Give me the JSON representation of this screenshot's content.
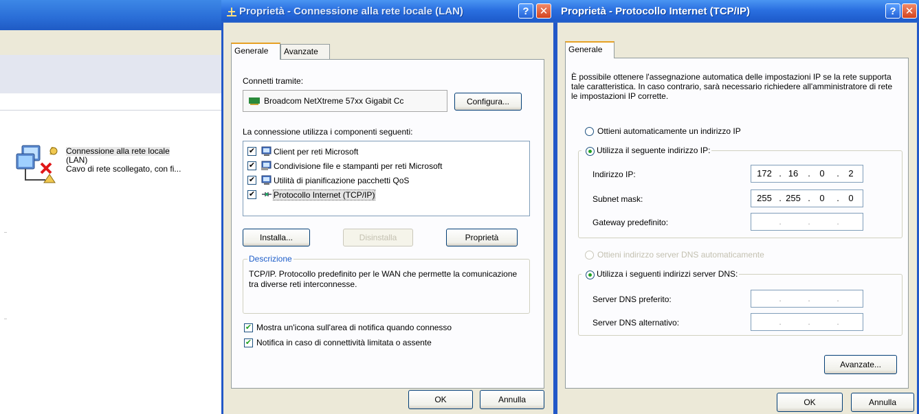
{
  "background_window": {
    "connection": {
      "name": "Connessione alla rete locale",
      "name_suffix": "(LAN)",
      "status": "Cavo di rete scollegato, con fi..."
    }
  },
  "lan_dialog": {
    "title": "Proprietà - Connessione alla rete locale (LAN)",
    "help_label": "?",
    "close_label": "✕",
    "tabs": [
      "Generale",
      "Avanzate"
    ],
    "connect_via_label": "Connetti tramite:",
    "adapter_name": "Broadcom NetXtreme 57xx Gigabit Cc",
    "configure_label": "Configura...",
    "components_label": "La connessione utilizza i componenti seguenti:",
    "components": [
      {
        "label": "Client per reti Microsoft",
        "checked": true,
        "icon": "network-client-icon"
      },
      {
        "label": "Condivisione file e stampanti per reti Microsoft",
        "checked": true,
        "icon": "file-printer-sharing-icon"
      },
      {
        "label": "Utilità di pianificazione pacchetti QoS",
        "checked": true,
        "icon": "qos-scheduler-icon"
      },
      {
        "label": "Protocollo Internet (TCP/IP)",
        "checked": true,
        "icon": "protocol-icon",
        "selected": true
      }
    ],
    "install_label": "Installa...",
    "uninstall_label": "Disinstalla",
    "properties_label": "Proprietà",
    "description_title": "Descrizione",
    "description_text": "TCP/IP. Protocollo predefinito per le WAN che permette la comunicazione tra diverse reti interconnesse.",
    "show_icon_label": "Mostra un'icona sull'area di notifica quando connesso",
    "notify_label": "Notifica in caso di connettività limitata o assente",
    "ok_label": "OK",
    "cancel_label": "Annulla"
  },
  "tcpip_dialog": {
    "title": "Proprietà - Protocollo Internet (TCP/IP)",
    "help_label": "?",
    "close_label": "✕",
    "tab": "Generale",
    "intro": "È possibile ottenere l'assegnazione automatica delle impostazioni IP se la rete supporta tale caratteristica. In caso contrario, sarà necessario richiedere all'amministratore di rete le impostazioni IP corrette.",
    "auto_ip_label": "Ottieni automaticamente un indirizzo IP",
    "manual_ip_label": "Utilizza il seguente indirizzo IP:",
    "ip_label": "Indirizzo IP:",
    "ip": [
      "172",
      "16",
      "0",
      "2"
    ],
    "mask_label": "Subnet mask:",
    "mask": [
      "255",
      "255",
      "0",
      "0"
    ],
    "gateway_label": "Gateway predefinito:",
    "auto_dns_label": "Ottieni indirizzo server DNS automaticamente",
    "manual_dns_label": "Utilizza i seguenti indirizzi server DNS:",
    "dns_pref_label": "Server DNS preferito:",
    "dns_alt_label": "Server DNS alternativo:",
    "advanced_label": "Avanzate...",
    "ok_label": "OK",
    "cancel_label": "Annulla"
  },
  "colors": {
    "titlebar": "#2a6fe0",
    "dialog_bg": "#ece9d8",
    "panel_bg": "#fcfcfe",
    "check_green": "#21a121"
  }
}
